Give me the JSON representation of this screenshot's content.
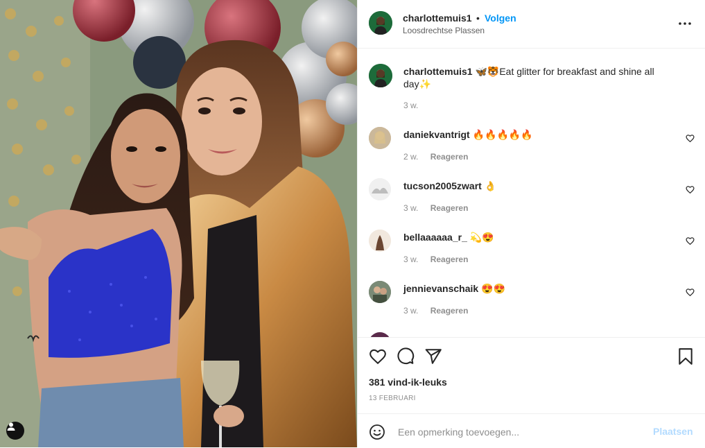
{
  "post": {
    "username": "charlottemuis1",
    "separator": "•",
    "follow_label": "Volgen",
    "location": "Loosdrechtse Plassen",
    "caption_text": "🦋🐯Eat glitter for breakfast and shine all day✨",
    "caption_time": "3 w."
  },
  "comments": [
    {
      "username": "daniekvantrigt",
      "text": "🔥🔥🔥🔥🔥",
      "time": "2 w.",
      "reply": "Reageren"
    },
    {
      "username": "tucson2005zwart",
      "text": "👌",
      "time": "3 w.",
      "reply": "Reageren"
    },
    {
      "username": "bellaaaaaa_r_",
      "text": "💫😍",
      "time": "3 w.",
      "reply": "Reageren"
    },
    {
      "username": "jennievanschaik",
      "text": "😍😍",
      "time": "3 w.",
      "reply": "Reageren"
    }
  ],
  "likes": "381 vind-ik-leuks",
  "date": "13 FEBRUARI",
  "composer": {
    "placeholder": "Een opmerking toevoegen...",
    "post_label": "Plaatsen"
  },
  "icons": {
    "more": "more-options-icon",
    "like": "heart-icon",
    "comment": "comment-icon",
    "share": "share-icon",
    "save": "bookmark-icon",
    "emoji": "emoji-icon",
    "user": "user-icon"
  },
  "colors": {
    "accent": "#0095f6",
    "post_disabled": "#b3dbff",
    "muted": "#8e8e8e"
  }
}
